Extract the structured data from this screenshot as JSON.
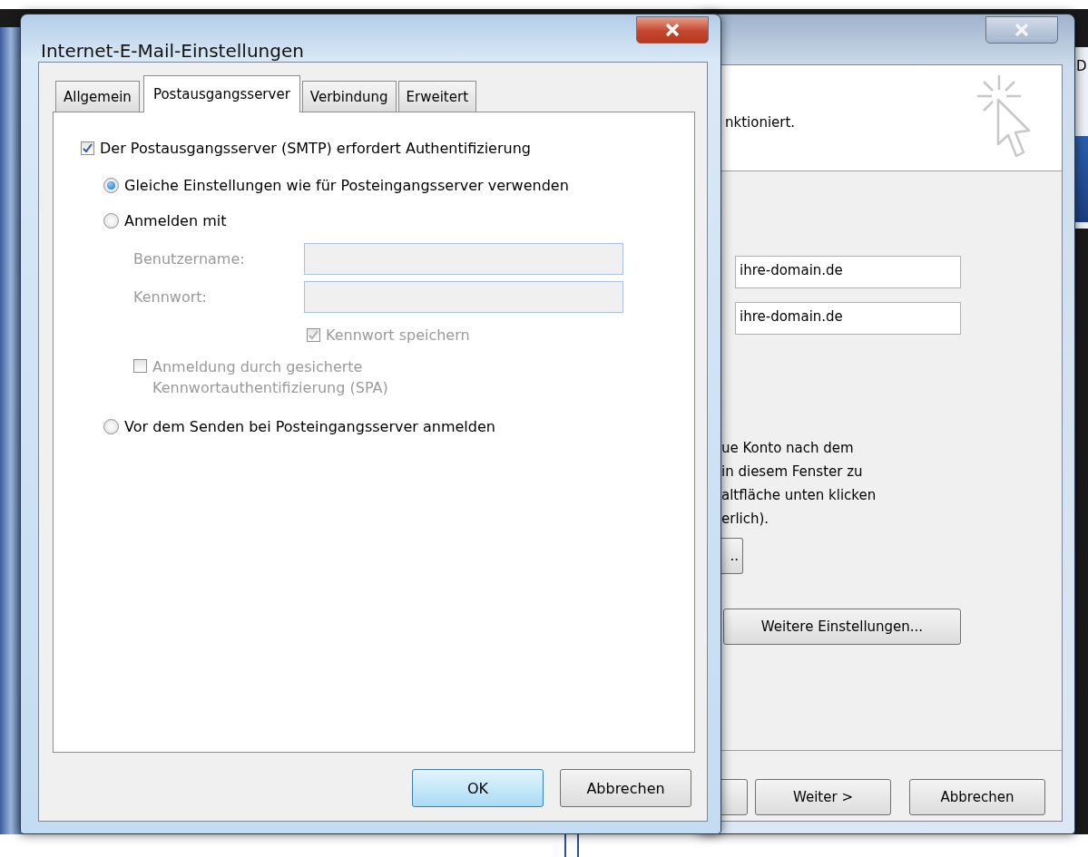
{
  "back_window": {
    "header_text": "nktioniert.",
    "fields": [
      {
        "value": "ihre-domain.de"
      },
      {
        "value": "ihre-domain.de"
      }
    ],
    "note_lines": [
      "ue Konto nach dem",
      "in diesem Fenster zu",
      "altfläche unten klicken",
      "erlich)."
    ],
    "partial_button": "..",
    "more_button": "Weitere Einstellungen...",
    "footer_buttons": [
      {
        "label": "Weiter >",
        "kind": "button"
      },
      {
        "label": "Abbrechen",
        "kind": "button"
      }
    ]
  },
  "edge_text": "D",
  "dialog": {
    "title": "Internet-E-Mail-Einstellungen",
    "tabs": [
      {
        "label": "Allgemein",
        "selected": false
      },
      {
        "label": "Postausgangsserver",
        "selected": true
      },
      {
        "label": "Verbindung",
        "selected": false
      },
      {
        "label": "Erweitert",
        "selected": false
      }
    ],
    "require_auth": {
      "label": "Der Postausgangsserver (SMTP) erfordert Authentifizierung",
      "checked": true
    },
    "options": [
      {
        "label": "Gleiche Einstellungen wie für Posteingangsserver verwenden",
        "selected": true
      },
      {
        "label": "Anmelden mit",
        "selected": false,
        "credentials": {
          "disabled": true,
          "fields": [
            {
              "label": "Benutzername:"
            },
            {
              "label": "Kennwort:"
            }
          ],
          "save_password": {
            "label": "Kennwort speichern",
            "checked": true
          },
          "spa": {
            "label": "Anmeldung durch gesicherte Kennwortauthentifizierung (SPA)",
            "checked": false
          }
        }
      },
      {
        "label": "Vor dem Senden bei Posteingangsserver anmelden",
        "selected": false
      }
    ],
    "buttons": [
      {
        "label": "OK",
        "default": true
      },
      {
        "label": "Abbrechen",
        "default": false
      }
    ]
  }
}
